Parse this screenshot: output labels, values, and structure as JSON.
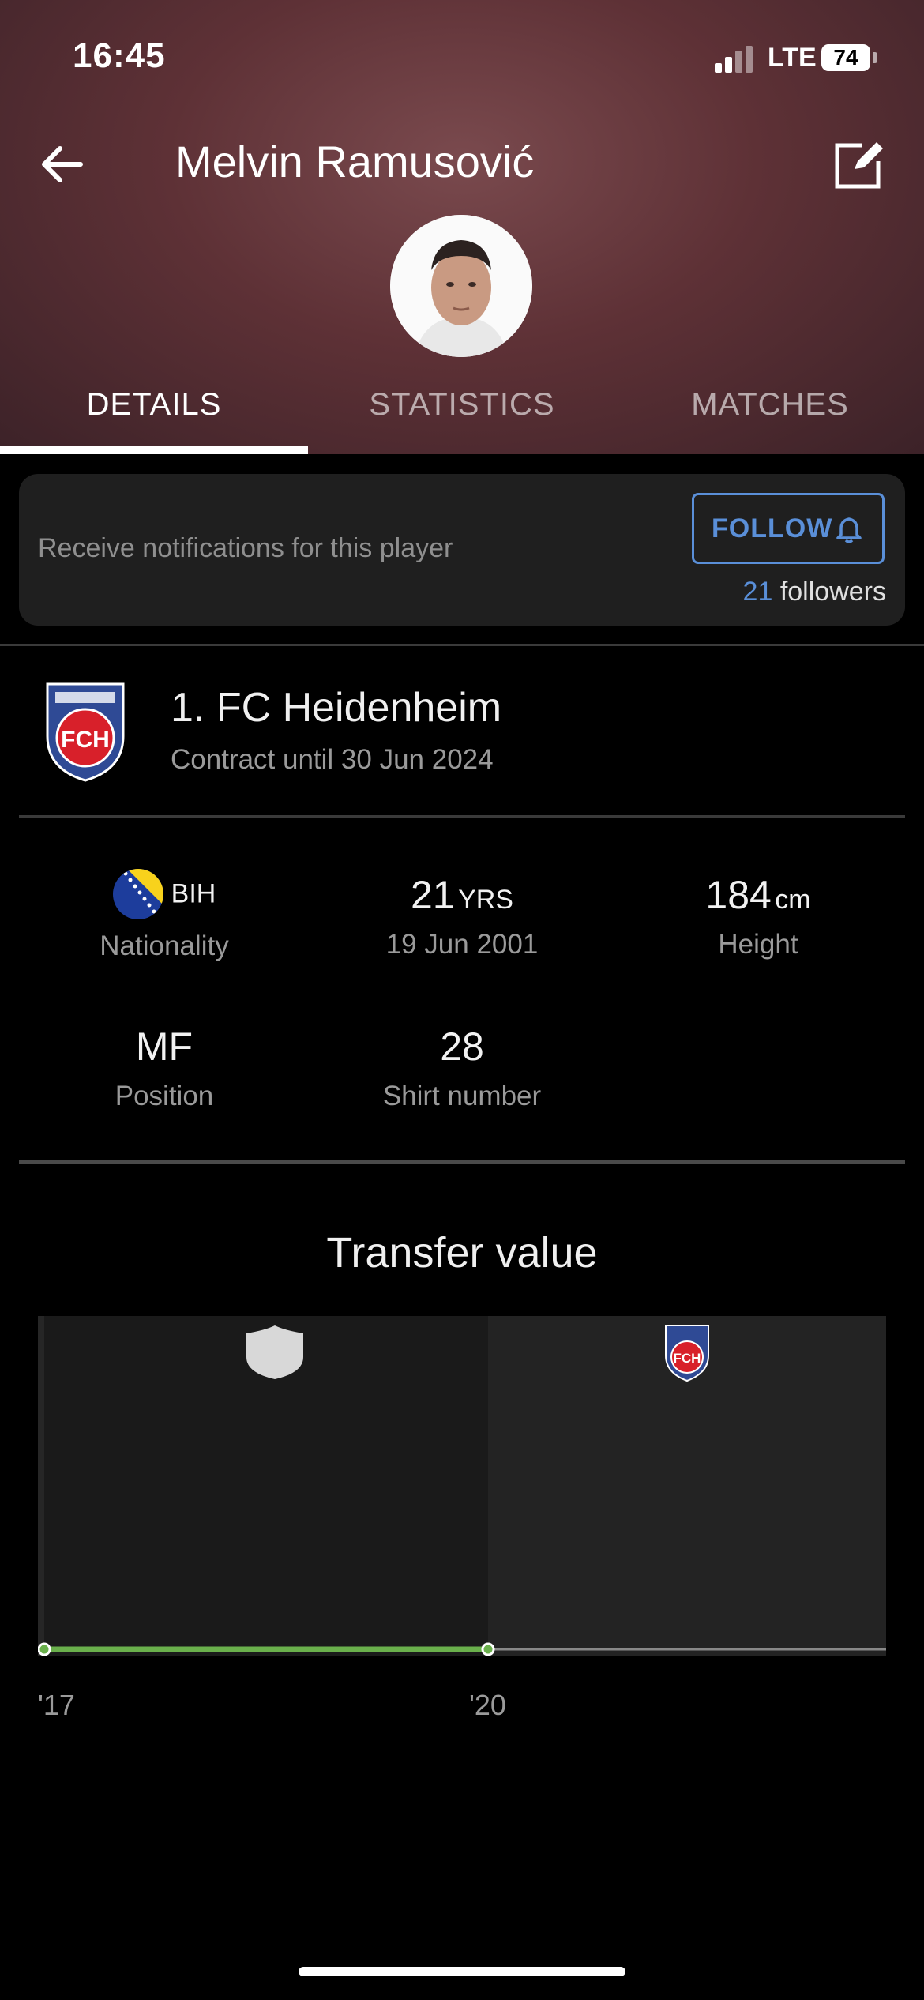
{
  "status": {
    "time": "16:45",
    "network": "LTE",
    "battery": "74"
  },
  "header": {
    "title": "Melvin Ramusović"
  },
  "tabs": [
    {
      "label": "DETAILS",
      "active": true
    },
    {
      "label": "STATISTICS",
      "active": false
    },
    {
      "label": "MATCHES",
      "active": false
    }
  ],
  "notifications": {
    "text": "Receive notifications for this player",
    "follow_label": "FOLLOW",
    "followers_count": "21",
    "followers_label": "followers"
  },
  "club": {
    "name": "1. FC Heidenheim",
    "contract": "Contract until 30 Jun 2024",
    "logo_text": "FCH"
  },
  "details": {
    "nationality": {
      "value": "BIH",
      "label": "Nationality"
    },
    "age": {
      "value": "21",
      "unit": "YRS",
      "label": "19 Jun 2001"
    },
    "height": {
      "value": "184",
      "unit": "cm",
      "label": "Height"
    },
    "position": {
      "value": "MF",
      "label": "Position"
    },
    "shirt": {
      "value": "28",
      "label": "Shirt number"
    }
  },
  "transfer": {
    "title": "Transfer value",
    "x_labels": [
      "'17",
      "'20"
    ]
  },
  "colors": {
    "accent": "#5a8fd8",
    "line": "#6ab04c"
  }
}
